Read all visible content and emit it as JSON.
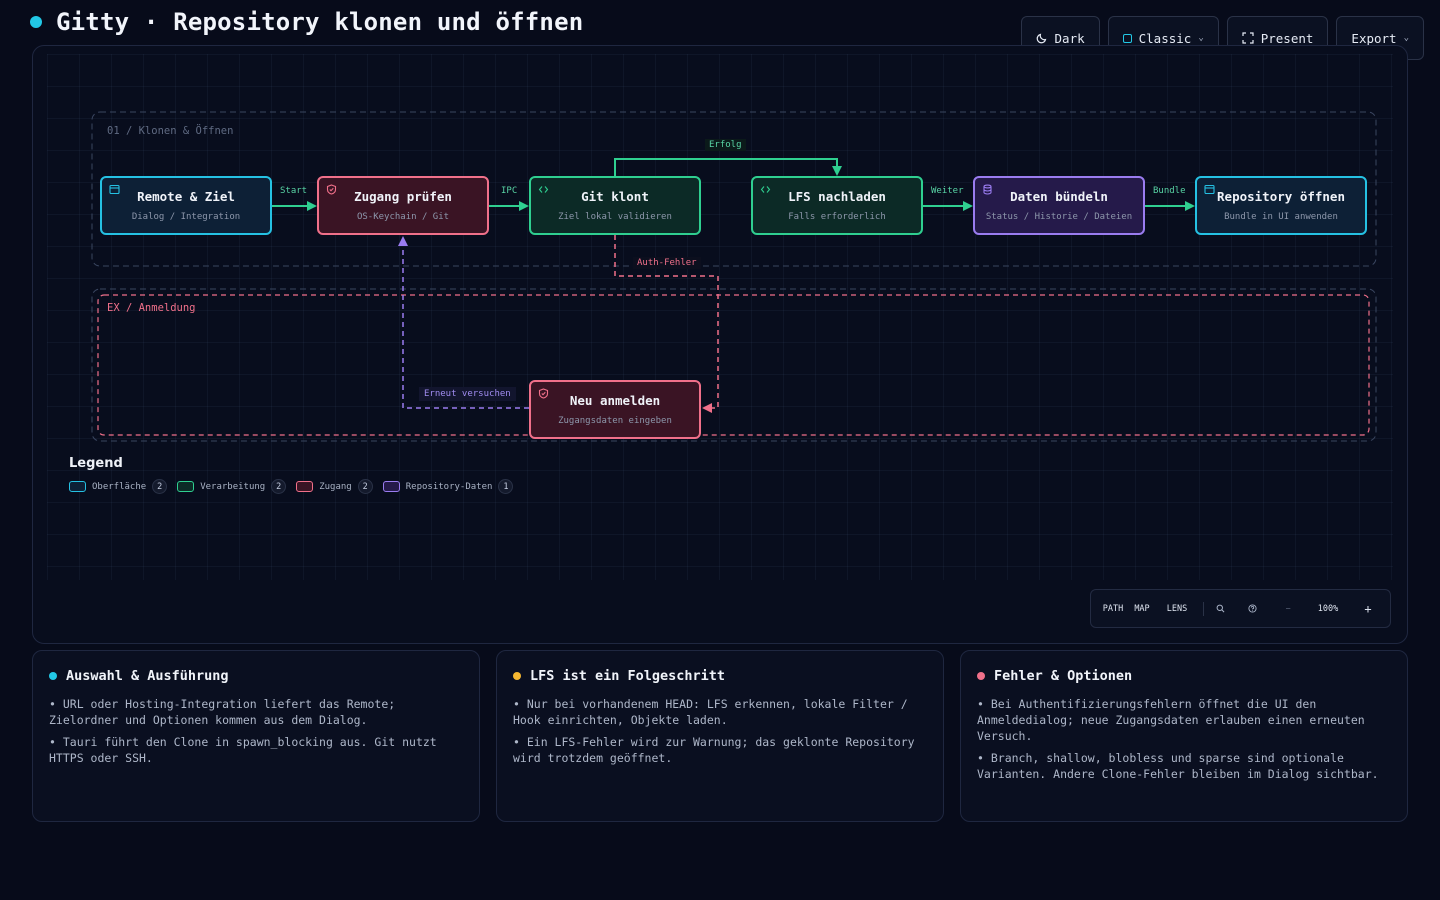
{
  "header": {
    "title": "Gitty · Repository klonen und öffnen",
    "dot_color": "#22c8e6"
  },
  "toolbar": {
    "dark_label": "Dark",
    "style_label": "Classic",
    "present_label": "Present",
    "export_label": "Export"
  },
  "diagram": {
    "group_main": "01 / Klonen & Öffnen",
    "group_ex": "EX / Anmeldung",
    "nodes": {
      "remote": {
        "title": "Remote & Ziel",
        "sub": "Dialog / Integration",
        "icon": "window-icon"
      },
      "access": {
        "title": "Zugang prüfen",
        "sub": "OS-Keychain / Git",
        "icon": "shield-icon"
      },
      "clone": {
        "title": "Git klont",
        "sub": "Ziel lokal validieren",
        "icon": "code-icon"
      },
      "lfs": {
        "title": "LFS nachladen",
        "sub": "Falls erforderlich",
        "icon": "code-icon"
      },
      "bundle": {
        "title": "Daten bündeln",
        "sub": "Status / Historie / Dateien",
        "icon": "database-icon"
      },
      "open": {
        "title": "Repository öffnen",
        "sub": "Bundle in UI anwenden",
        "icon": "window-icon"
      },
      "relogin": {
        "title": "Neu anmelden",
        "sub": "Zugangsdaten eingeben",
        "icon": "shield-icon"
      }
    },
    "edges": {
      "start": "Start",
      "ipc": "IPC",
      "success": "Erfolg",
      "next": "Weiter",
      "bundle": "Bundle",
      "auth_error": "Auth-Fehler",
      "retry": "Erneut versuchen"
    },
    "colors": {
      "surface": "#25c1e3",
      "processing": "#2fcf90",
      "access": "#f0708a",
      "repo_data": "#9a7cf0"
    }
  },
  "legend": {
    "title": "Legend",
    "items": [
      {
        "label": "Oberfläche",
        "count": "2"
      },
      {
        "label": "Verarbeitung",
        "count": "2"
      },
      {
        "label": "Zugang",
        "count": "2"
      },
      {
        "label": "Repository-Daten",
        "count": "1"
      }
    ]
  },
  "controls": {
    "path": "PATH",
    "map": "MAP",
    "lens": "LENS",
    "zoom": "100%",
    "minus": "−",
    "plus": "+"
  },
  "cards": [
    {
      "title": "Auswahl & Ausführung",
      "dot": "#22c8e6",
      "bullets": [
        "• URL oder Hosting-Integration liefert das Remote; Zielordner und Optionen kommen aus dem Dialog.",
        "• Tauri führt den Clone in spawn_blocking aus. Git nutzt HTTPS oder SSH."
      ]
    },
    {
      "title": "LFS ist ein Folgeschritt",
      "dot": "#f5b731",
      "bullets": [
        "• Nur bei vorhandenem HEAD: LFS erkennen, lokale Filter / Hook einrichten, Objekte laden.",
        "• Ein LFS-Fehler wird zur Warnung; das geklonte Repository wird trotzdem geöffnet."
      ]
    },
    {
      "title": "Fehler & Optionen",
      "dot": "#f0708a",
      "bullets": [
        "• Bei Authentifizierungsfehlern öffnet die UI den Anmeldedialog; neue Zugangsdaten erlauben einen erneuten Versuch.",
        "• Branch, shallow, blobless und sparse sind optionale Varianten. Andere Clone-Fehler bleiben im Dialog sichtbar."
      ]
    }
  ]
}
